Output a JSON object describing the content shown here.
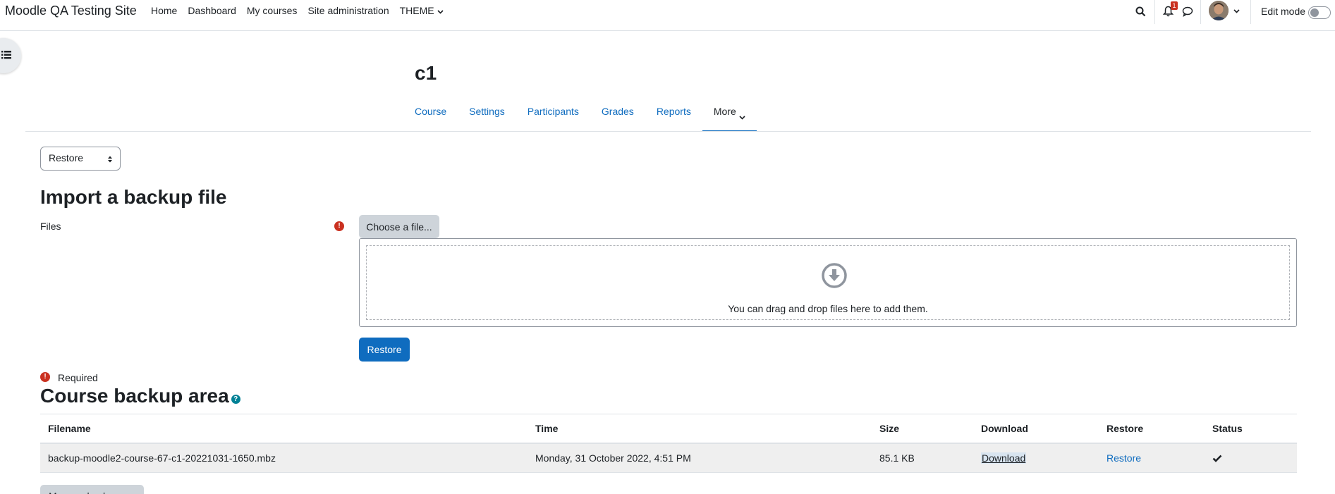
{
  "navbar": {
    "site_name": "Moodle QA Testing Site",
    "links": [
      "Home",
      "Dashboard",
      "My courses",
      "Site administration",
      "THEME"
    ],
    "notification_count": "1",
    "edit_mode_label": "Edit mode"
  },
  "course": {
    "title": "c1",
    "tabs": [
      "Course",
      "Settings",
      "Participants",
      "Grades",
      "Reports",
      "More"
    ]
  },
  "action_select": {
    "value": "Restore"
  },
  "import": {
    "heading": "Import a backup file",
    "files_label": "Files",
    "choose_button": "Choose a file...",
    "drop_text": "You can drag and drop files here to add them.",
    "restore_button": "Restore",
    "required_label": "Required"
  },
  "backup_area": {
    "heading": "Course backup area",
    "headers": [
      "Filename",
      "Time",
      "Size",
      "Download",
      "Restore",
      "Status"
    ],
    "rows": [
      {
        "filename": "backup-moodle2-course-67-c1-20221031-1650.mbz",
        "time": "Monday, 31 October 2022, 4:51 PM",
        "size": "85.1 KB",
        "download": "Download",
        "restore": "Restore",
        "status_icon": "check-icon"
      }
    ],
    "manage_button": "Manage backup files"
  },
  "colors": {
    "primary": "#0f6cbf",
    "danger": "#ca3120",
    "info": "#008196"
  }
}
